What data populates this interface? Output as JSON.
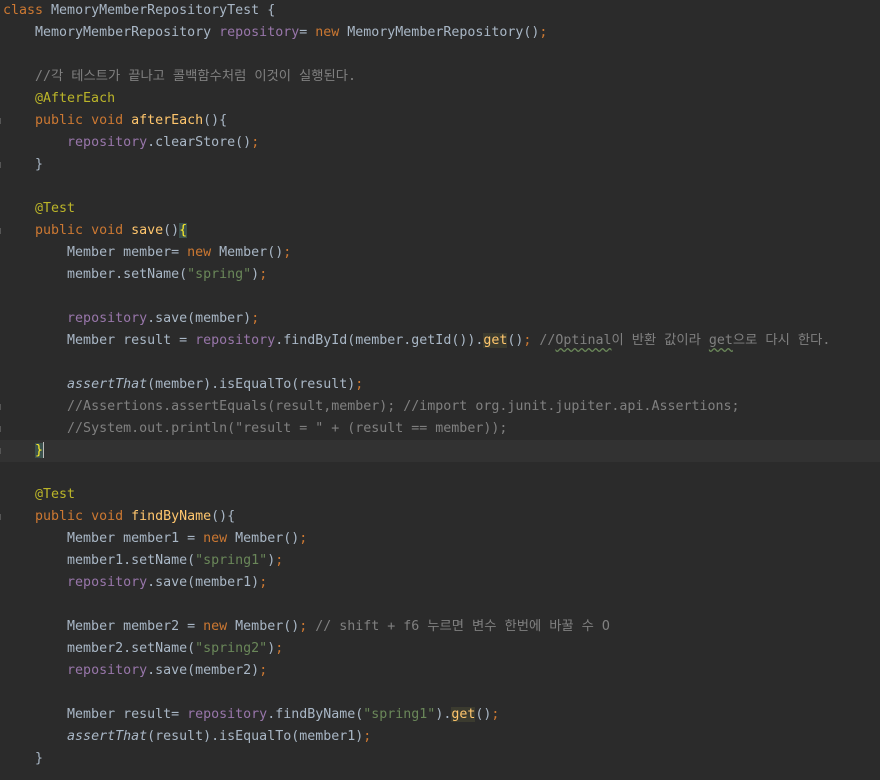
{
  "editor": {
    "language": "java",
    "lines": [
      {
        "tokens": [
          {
            "t": "class ",
            "c": "kw"
          },
          {
            "t": "MemoryMemberRepositoryTest {",
            "c": "plain"
          }
        ]
      },
      {
        "tokens": [
          {
            "t": "    MemoryMemberRepository ",
            "c": "plain"
          },
          {
            "t": "repository",
            "c": "field"
          },
          {
            "t": "= ",
            "c": "plain"
          },
          {
            "t": "new ",
            "c": "kw"
          },
          {
            "t": "MemoryMemberRepository()",
            "c": "plain"
          },
          {
            "t": ";",
            "c": "kw"
          }
        ]
      },
      {
        "tokens": []
      },
      {
        "tokens": [
          {
            "t": "    //각 테스트가 끝나고 콜백함수처럼 이것이 실행된다.",
            "c": "cmt"
          }
        ]
      },
      {
        "tokens": [
          {
            "t": "    @AfterEach",
            "c": "ann"
          }
        ]
      },
      {
        "gutter": true,
        "tokens": [
          {
            "t": "    ",
            "c": "plain"
          },
          {
            "t": "public void ",
            "c": "kw"
          },
          {
            "t": "afterEach",
            "c": "method"
          },
          {
            "t": "(){",
            "c": "plain"
          }
        ]
      },
      {
        "tokens": [
          {
            "t": "        ",
            "c": "plain"
          },
          {
            "t": "repository",
            "c": "field"
          },
          {
            "t": ".clearStore()",
            "c": "plain"
          },
          {
            "t": ";",
            "c": "kw"
          }
        ]
      },
      {
        "gutter": true,
        "tokens": [
          {
            "t": "    }",
            "c": "plain"
          }
        ]
      },
      {
        "tokens": []
      },
      {
        "tokens": [
          {
            "t": "    @Test",
            "c": "ann"
          }
        ]
      },
      {
        "gutter": true,
        "tokens": [
          {
            "t": "    ",
            "c": "plain"
          },
          {
            "t": "public void ",
            "c": "kw"
          },
          {
            "t": "save",
            "c": "method"
          },
          {
            "t": "()",
            "c": "plain"
          },
          {
            "t": "{",
            "c": "brace"
          }
        ]
      },
      {
        "tokens": [
          {
            "t": "        Member member= ",
            "c": "plain"
          },
          {
            "t": "new ",
            "c": "kw"
          },
          {
            "t": "Member()",
            "c": "plain"
          },
          {
            "t": ";",
            "c": "kw"
          }
        ]
      },
      {
        "tokens": [
          {
            "t": "        member.setName(",
            "c": "plain"
          },
          {
            "t": "\"spring\"",
            "c": "str"
          },
          {
            "t": ")",
            "c": "plain"
          },
          {
            "t": ";",
            "c": "kw"
          }
        ]
      },
      {
        "tokens": []
      },
      {
        "tokens": [
          {
            "t": "        ",
            "c": "plain"
          },
          {
            "t": "repository",
            "c": "field"
          },
          {
            "t": ".save(member)",
            "c": "plain"
          },
          {
            "t": ";",
            "c": "kw"
          }
        ]
      },
      {
        "tokens": [
          {
            "t": "        Member result = ",
            "c": "plain"
          },
          {
            "t": "repository",
            "c": "field"
          },
          {
            "t": ".findById(member.getId()).",
            "c": "plain"
          },
          {
            "t": "get",
            "c": "hl2"
          },
          {
            "t": "()",
            "c": "plain"
          },
          {
            "t": "; ",
            "c": "kw"
          },
          {
            "t": "//",
            "c": "cmt"
          },
          {
            "t": "Optinal",
            "c": "cmt-typo"
          },
          {
            "t": "이 반환 값이라 ",
            "c": "cmt"
          },
          {
            "t": "get",
            "c": "cmt-typo"
          },
          {
            "t": "으로 다시 한다.",
            "c": "cmt"
          }
        ]
      },
      {
        "tokens": []
      },
      {
        "tokens": [
          {
            "t": "        ",
            "c": "plain"
          },
          {
            "t": "assertThat",
            "c": "italic"
          },
          {
            "t": "(member).isEqualTo(result)",
            "c": "plain"
          },
          {
            "t": ";",
            "c": "kw"
          }
        ]
      },
      {
        "gutter": true,
        "tokens": [
          {
            "t": "        ",
            "c": "plain"
          },
          {
            "t": "//Assertions.assertEquals(result,member); //import org.junit.jupiter.api.Assertions;",
            "c": "cmt"
          }
        ]
      },
      {
        "gutter": true,
        "tokens": [
          {
            "t": "        ",
            "c": "plain"
          },
          {
            "t": "//System.out.println(\"result = \" + (result == member));",
            "c": "cmt"
          }
        ]
      },
      {
        "current": true,
        "gutter": true,
        "tokens": [
          {
            "t": "    ",
            "c": "plain"
          },
          {
            "t": "}",
            "c": "brace"
          },
          {
            "t": "",
            "c": "caret"
          }
        ]
      },
      {
        "tokens": []
      },
      {
        "tokens": [
          {
            "t": "    @Test",
            "c": "ann"
          }
        ]
      },
      {
        "gutter": true,
        "tokens": [
          {
            "t": "    ",
            "c": "plain"
          },
          {
            "t": "public void ",
            "c": "kw"
          },
          {
            "t": "findByName",
            "c": "method"
          },
          {
            "t": "(){",
            "c": "plain"
          }
        ]
      },
      {
        "tokens": [
          {
            "t": "        Member member1 = ",
            "c": "plain"
          },
          {
            "t": "new ",
            "c": "kw"
          },
          {
            "t": "Member()",
            "c": "plain"
          },
          {
            "t": ";",
            "c": "kw"
          }
        ]
      },
      {
        "tokens": [
          {
            "t": "        member1.setName(",
            "c": "plain"
          },
          {
            "t": "\"spring1\"",
            "c": "str"
          },
          {
            "t": ")",
            "c": "plain"
          },
          {
            "t": ";",
            "c": "kw"
          }
        ]
      },
      {
        "tokens": [
          {
            "t": "        ",
            "c": "plain"
          },
          {
            "t": "repository",
            "c": "field"
          },
          {
            "t": ".save(member1)",
            "c": "plain"
          },
          {
            "t": ";",
            "c": "kw"
          }
        ]
      },
      {
        "tokens": []
      },
      {
        "tokens": [
          {
            "t": "        Member member2 = ",
            "c": "plain"
          },
          {
            "t": "new ",
            "c": "kw"
          },
          {
            "t": "Member()",
            "c": "plain"
          },
          {
            "t": "; ",
            "c": "kw"
          },
          {
            "t": "// shift + f6 누르면 변수 한번에 바꿀 수 O",
            "c": "cmt"
          }
        ]
      },
      {
        "tokens": [
          {
            "t": "        member2.setName(",
            "c": "plain"
          },
          {
            "t": "\"spring2\"",
            "c": "str"
          },
          {
            "t": ")",
            "c": "plain"
          },
          {
            "t": ";",
            "c": "kw"
          }
        ]
      },
      {
        "tokens": [
          {
            "t": "        ",
            "c": "plain"
          },
          {
            "t": "repository",
            "c": "field"
          },
          {
            "t": ".save(member2)",
            "c": "plain"
          },
          {
            "t": ";",
            "c": "kw"
          }
        ]
      },
      {
        "tokens": []
      },
      {
        "tokens": [
          {
            "t": "        Member result= ",
            "c": "plain"
          },
          {
            "t": "repository",
            "c": "field"
          },
          {
            "t": ".findByName(",
            "c": "plain"
          },
          {
            "t": "\"spring1\"",
            "c": "str"
          },
          {
            "t": ").",
            "c": "plain"
          },
          {
            "t": "get",
            "c": "hl2"
          },
          {
            "t": "()",
            "c": "plain"
          },
          {
            "t": ";",
            "c": "kw"
          }
        ]
      },
      {
        "tokens": [
          {
            "t": "        ",
            "c": "plain"
          },
          {
            "t": "assertThat",
            "c": "italic"
          },
          {
            "t": "(result).isEqualTo(member1)",
            "c": "plain"
          },
          {
            "t": ";",
            "c": "kw"
          }
        ]
      },
      {
        "tokens": [
          {
            "t": "    }",
            "c": "plain"
          }
        ]
      }
    ]
  }
}
